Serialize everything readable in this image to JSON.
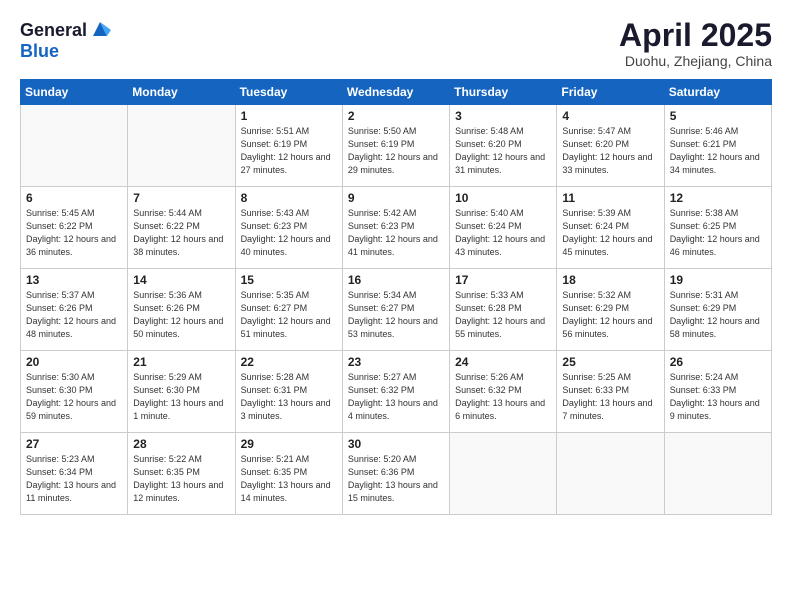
{
  "header": {
    "logo_general": "General",
    "logo_blue": "Blue",
    "title": "April 2025",
    "location": "Duohu, Zhejiang, China"
  },
  "days_of_week": [
    "Sunday",
    "Monday",
    "Tuesday",
    "Wednesday",
    "Thursday",
    "Friday",
    "Saturday"
  ],
  "weeks": [
    [
      {
        "day": "",
        "info": ""
      },
      {
        "day": "",
        "info": ""
      },
      {
        "day": "1",
        "info": "Sunrise: 5:51 AM\nSunset: 6:19 PM\nDaylight: 12 hours and 27 minutes."
      },
      {
        "day": "2",
        "info": "Sunrise: 5:50 AM\nSunset: 6:19 PM\nDaylight: 12 hours and 29 minutes."
      },
      {
        "day": "3",
        "info": "Sunrise: 5:48 AM\nSunset: 6:20 PM\nDaylight: 12 hours and 31 minutes."
      },
      {
        "day": "4",
        "info": "Sunrise: 5:47 AM\nSunset: 6:20 PM\nDaylight: 12 hours and 33 minutes."
      },
      {
        "day": "5",
        "info": "Sunrise: 5:46 AM\nSunset: 6:21 PM\nDaylight: 12 hours and 34 minutes."
      }
    ],
    [
      {
        "day": "6",
        "info": "Sunrise: 5:45 AM\nSunset: 6:22 PM\nDaylight: 12 hours and 36 minutes."
      },
      {
        "day": "7",
        "info": "Sunrise: 5:44 AM\nSunset: 6:22 PM\nDaylight: 12 hours and 38 minutes."
      },
      {
        "day": "8",
        "info": "Sunrise: 5:43 AM\nSunset: 6:23 PM\nDaylight: 12 hours and 40 minutes."
      },
      {
        "day": "9",
        "info": "Sunrise: 5:42 AM\nSunset: 6:23 PM\nDaylight: 12 hours and 41 minutes."
      },
      {
        "day": "10",
        "info": "Sunrise: 5:40 AM\nSunset: 6:24 PM\nDaylight: 12 hours and 43 minutes."
      },
      {
        "day": "11",
        "info": "Sunrise: 5:39 AM\nSunset: 6:24 PM\nDaylight: 12 hours and 45 minutes."
      },
      {
        "day": "12",
        "info": "Sunrise: 5:38 AM\nSunset: 6:25 PM\nDaylight: 12 hours and 46 minutes."
      }
    ],
    [
      {
        "day": "13",
        "info": "Sunrise: 5:37 AM\nSunset: 6:26 PM\nDaylight: 12 hours and 48 minutes."
      },
      {
        "day": "14",
        "info": "Sunrise: 5:36 AM\nSunset: 6:26 PM\nDaylight: 12 hours and 50 minutes."
      },
      {
        "day": "15",
        "info": "Sunrise: 5:35 AM\nSunset: 6:27 PM\nDaylight: 12 hours and 51 minutes."
      },
      {
        "day": "16",
        "info": "Sunrise: 5:34 AM\nSunset: 6:27 PM\nDaylight: 12 hours and 53 minutes."
      },
      {
        "day": "17",
        "info": "Sunrise: 5:33 AM\nSunset: 6:28 PM\nDaylight: 12 hours and 55 minutes."
      },
      {
        "day": "18",
        "info": "Sunrise: 5:32 AM\nSunset: 6:29 PM\nDaylight: 12 hours and 56 minutes."
      },
      {
        "day": "19",
        "info": "Sunrise: 5:31 AM\nSunset: 6:29 PM\nDaylight: 12 hours and 58 minutes."
      }
    ],
    [
      {
        "day": "20",
        "info": "Sunrise: 5:30 AM\nSunset: 6:30 PM\nDaylight: 12 hours and 59 minutes."
      },
      {
        "day": "21",
        "info": "Sunrise: 5:29 AM\nSunset: 6:30 PM\nDaylight: 13 hours and 1 minute."
      },
      {
        "day": "22",
        "info": "Sunrise: 5:28 AM\nSunset: 6:31 PM\nDaylight: 13 hours and 3 minutes."
      },
      {
        "day": "23",
        "info": "Sunrise: 5:27 AM\nSunset: 6:32 PM\nDaylight: 13 hours and 4 minutes."
      },
      {
        "day": "24",
        "info": "Sunrise: 5:26 AM\nSunset: 6:32 PM\nDaylight: 13 hours and 6 minutes."
      },
      {
        "day": "25",
        "info": "Sunrise: 5:25 AM\nSunset: 6:33 PM\nDaylight: 13 hours and 7 minutes."
      },
      {
        "day": "26",
        "info": "Sunrise: 5:24 AM\nSunset: 6:33 PM\nDaylight: 13 hours and 9 minutes."
      }
    ],
    [
      {
        "day": "27",
        "info": "Sunrise: 5:23 AM\nSunset: 6:34 PM\nDaylight: 13 hours and 11 minutes."
      },
      {
        "day": "28",
        "info": "Sunrise: 5:22 AM\nSunset: 6:35 PM\nDaylight: 13 hours and 12 minutes."
      },
      {
        "day": "29",
        "info": "Sunrise: 5:21 AM\nSunset: 6:35 PM\nDaylight: 13 hours and 14 minutes."
      },
      {
        "day": "30",
        "info": "Sunrise: 5:20 AM\nSunset: 6:36 PM\nDaylight: 13 hours and 15 minutes."
      },
      {
        "day": "",
        "info": ""
      },
      {
        "day": "",
        "info": ""
      },
      {
        "day": "",
        "info": ""
      }
    ]
  ]
}
